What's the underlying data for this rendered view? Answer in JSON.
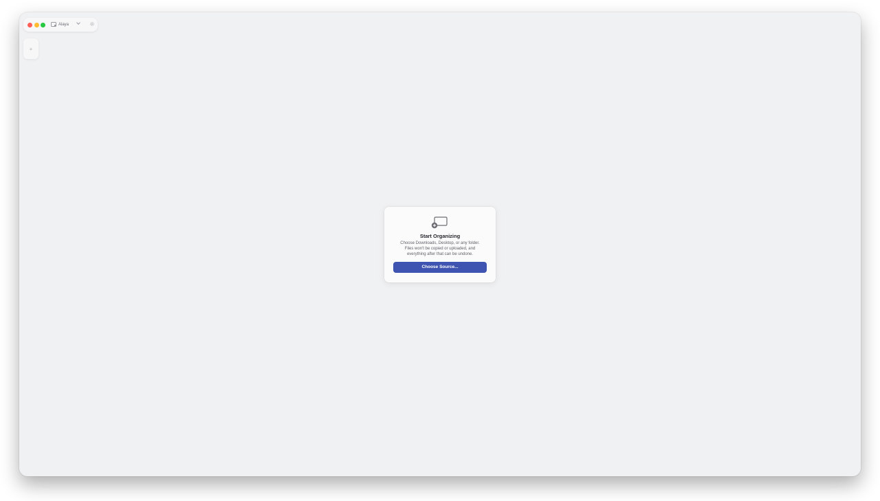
{
  "window": {
    "workspace_name": "Alaya",
    "workspace_icon": "folder-icon",
    "settings_icon": "gear-icon"
  },
  "sidebar": {
    "add_label": "+"
  },
  "empty_state": {
    "icon": "add-folder-icon",
    "title": "Start Organizing",
    "description_line1": "Choose Downloads, Desktop, or any folder.",
    "description_line2": "Files won't be copied or uploaded, and",
    "description_line3": "everything after that can be undone.",
    "button_label": "Choose Source..."
  },
  "colors": {
    "accent": "#3f54b0",
    "background": "#f0f1f3",
    "close": "#ff5f57",
    "minimize": "#febc2e",
    "maximize": "#28c840"
  }
}
